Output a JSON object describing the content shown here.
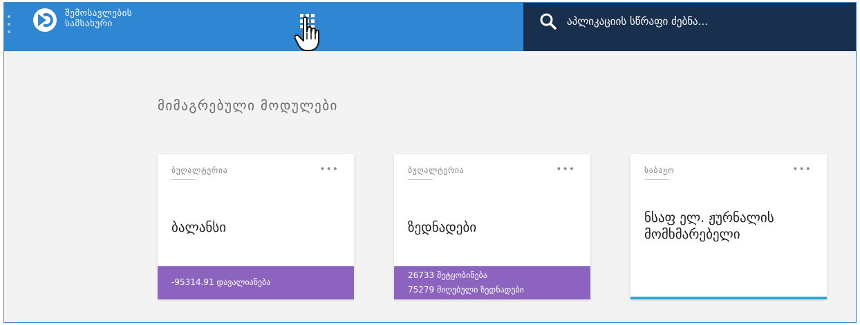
{
  "header": {
    "brand_line1": "შემოსავლების",
    "brand_line2": "სამსახური",
    "search_placeholder": "აპლიკაციის სწრაფი ძებნა...",
    "colors": {
      "primary": "#2f86d2",
      "dark": "#18304d"
    }
  },
  "main": {
    "section_title": "მიმაგრებული მოდულები",
    "cards": [
      {
        "category": "ბუღალტერია",
        "title": "ბალანსი",
        "menu": "•••",
        "footer_lines": [
          "-95314.91 დავალიანება"
        ],
        "footer_color": "#8c64c0"
      },
      {
        "category": "ბუღალტერია",
        "title": "ზედნადები",
        "menu": "•••",
        "footer_lines": [
          "26733 შეტყობინება",
          "75279 მიღებული ზედნადები"
        ],
        "footer_color": "#8c64c0"
      },
      {
        "category": "საბაჟო",
        "title": "ნსაფ ელ. ჟურნალის მომხმარებელი",
        "menu": "•••",
        "accent_color": "#2fa6cf"
      }
    ]
  }
}
